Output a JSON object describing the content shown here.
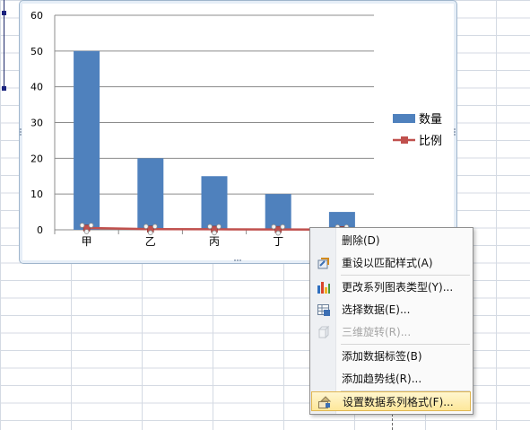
{
  "chart_data": {
    "type": "bar",
    "categories": [
      "甲",
      "乙",
      "丙",
      "丁",
      ""
    ],
    "series": [
      {
        "name": "数量",
        "kind": "bar",
        "color": "#4f81bd",
        "values": [
          50,
          20,
          15,
          10,
          5
        ]
      },
      {
        "name": "比例",
        "kind": "line",
        "color": "#c0504d",
        "values": [
          0.5,
          0.2,
          0.15,
          0.1,
          0.05
        ]
      }
    ],
    "y_ticks": [
      "0",
      "10",
      "20",
      "30",
      "40",
      "50",
      "60"
    ],
    "ylim": [
      0,
      60
    ],
    "grid": true,
    "legend_position": "right"
  },
  "context_menu": {
    "items": [
      {
        "label": "删除(D)",
        "icon": "",
        "enabled": true
      },
      {
        "label": "重设以匹配样式(A)",
        "icon": "reset-style-icon",
        "enabled": true
      },
      {
        "label": "更改系列图表类型(Y)...",
        "icon": "chart-type-icon",
        "enabled": true
      },
      {
        "label": "选择数据(E)...",
        "icon": "select-data-icon",
        "enabled": true
      },
      {
        "label": "三维旋转(R)...",
        "icon": "3d-rotation-icon",
        "enabled": false
      },
      {
        "label": "添加数据标签(B)",
        "icon": "",
        "enabled": true
      },
      {
        "label": "添加趋势线(R)...",
        "icon": "",
        "enabled": true
      },
      {
        "label": "设置数据系列格式(F)...",
        "icon": "format-series-icon",
        "enabled": true,
        "highlighted": true
      }
    ]
  }
}
